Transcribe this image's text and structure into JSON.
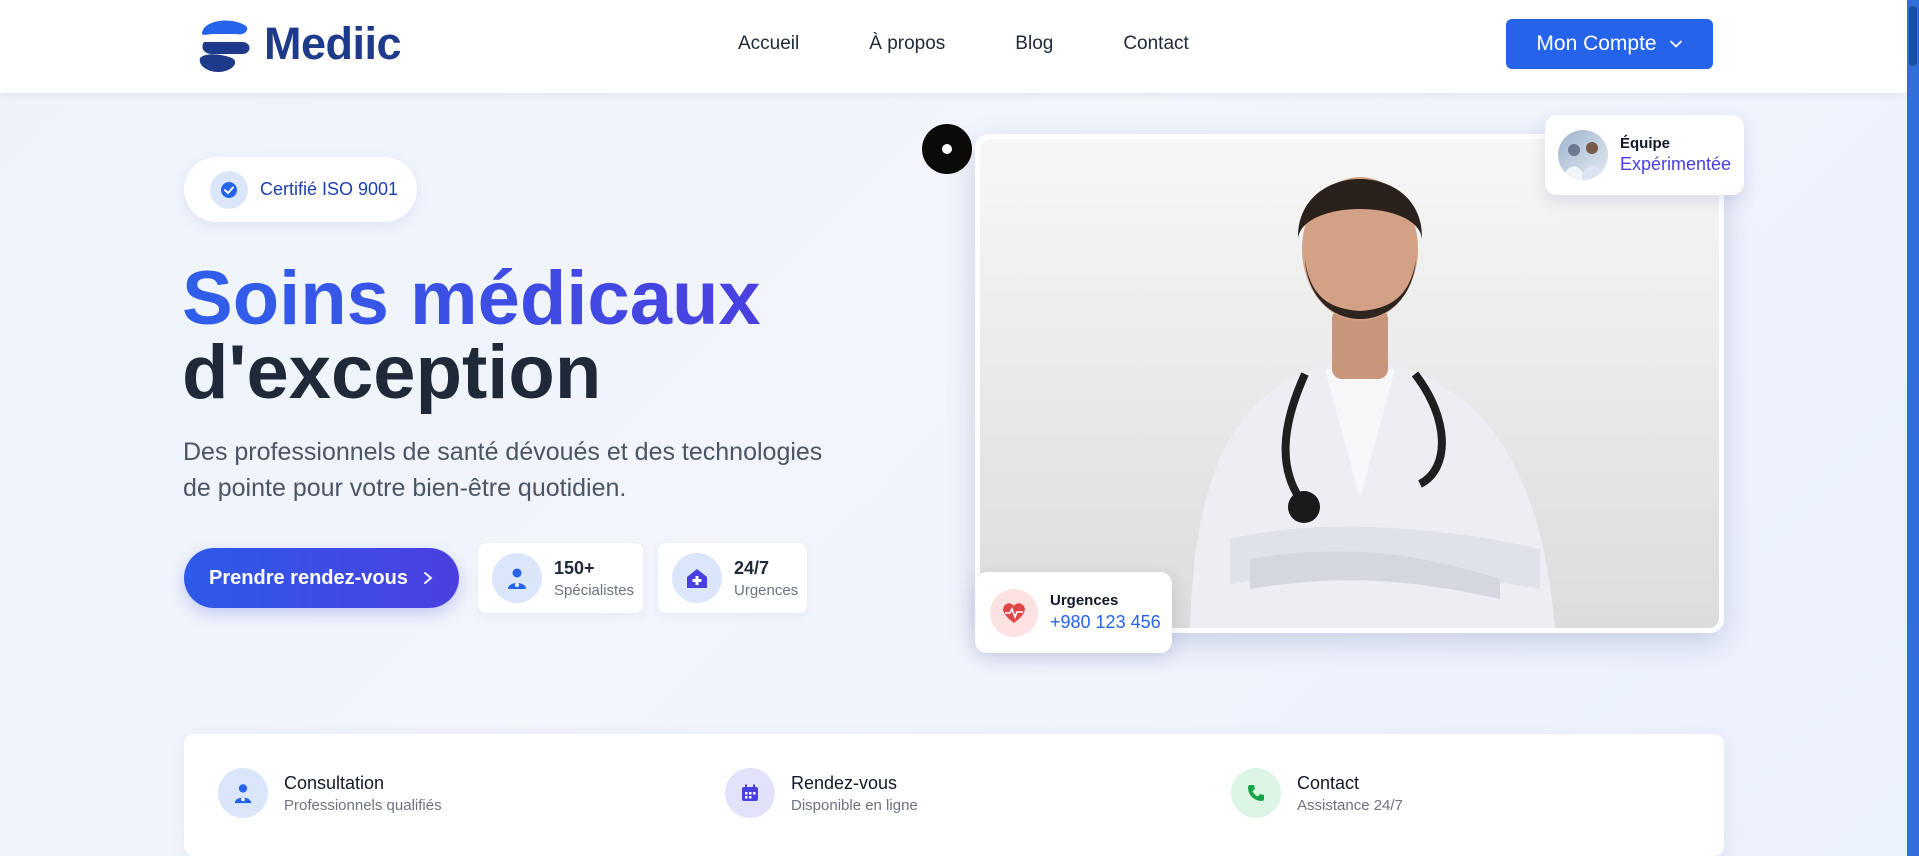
{
  "brand": {
    "name": "Mediic",
    "logo_icon": "mediic-logo-icon"
  },
  "nav": {
    "items": [
      {
        "label": "Accueil"
      },
      {
        "label": "À propos"
      },
      {
        "label": "Blog"
      },
      {
        "label": "Contact"
      }
    ]
  },
  "account": {
    "label": "Mon Compte",
    "icon": "chevron-down-icon"
  },
  "badge": {
    "label": "Certifié ISO 9001",
    "icon": "check-circle-icon"
  },
  "hero": {
    "title_line1": "Soins médicaux",
    "title_line2": "d'exception",
    "subtitle": "Des professionnels de santé dévoués et des technologies de pointe pour votre bien-être quotidien.",
    "cta_label": "Prendre rendez-vous",
    "cta_icon": "chevron-right-icon"
  },
  "stats": [
    {
      "value": "150+",
      "label": "Spécialistes",
      "icon": "doctor-icon"
    },
    {
      "value": "24/7",
      "label": "Urgences",
      "icon": "hospital-icon"
    }
  ],
  "team_card": {
    "title": "Équipe",
    "subtitle": "Expérimentée"
  },
  "urgences_card": {
    "title": "Urgences",
    "phone": "+980 123 456",
    "icon": "heartbeat-icon"
  },
  "features": [
    {
      "title": "Consultation",
      "subtitle": "Professionnels qualifiés",
      "icon": "doctor-icon"
    },
    {
      "title": "Rendez-vous",
      "subtitle": "Disponible en ligne",
      "icon": "calendar-icon"
    },
    {
      "title": "Contact",
      "subtitle": "Assistance 24/7",
      "icon": "phone-icon"
    }
  ],
  "colors": {
    "primary": "#2563eb",
    "indigo": "#4a40e0",
    "dark": "#1f2937",
    "brand": "#1e3a8a",
    "danger": "#e04848",
    "success": "#16a34a"
  }
}
